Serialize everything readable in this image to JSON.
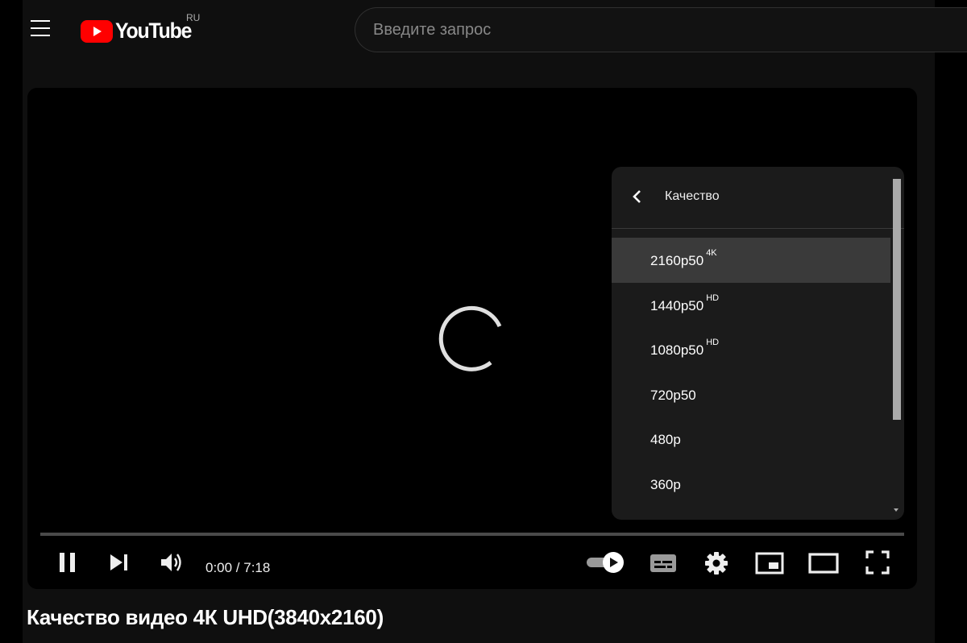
{
  "header": {
    "logo_text": "YouTube",
    "region": "RU",
    "search_placeholder": "Введите запрос"
  },
  "player": {
    "quality_menu": {
      "title": "Качество",
      "items": [
        {
          "label": "2160p50",
          "badge": "4K",
          "selected": true
        },
        {
          "label": "1440p50",
          "badge": "HD"
        },
        {
          "label": "1080p50",
          "badge": "HD"
        },
        {
          "label": "720p50",
          "badge": ""
        },
        {
          "label": "480p",
          "badge": ""
        },
        {
          "label": "360p",
          "badge": ""
        }
      ]
    },
    "time": "0:00 / 7:18",
    "progress": 0,
    "autoplay": true
  },
  "video": {
    "title": "Качество видео 4К UHD(3840x2160)"
  },
  "icons": [
    "menu-icon",
    "youtube-logo-icon",
    "back-chevron-icon",
    "pause-icon",
    "next-icon",
    "volume-icon",
    "autoplay-toggle-icon",
    "subtitles-icon",
    "settings-icon",
    "miniplayer-icon",
    "theater-mode-icon",
    "fullscreen-icon",
    "loading-spinner-icon"
  ],
  "colors": {
    "brand_red": "#ff0000",
    "background": "#0f0f0f"
  }
}
